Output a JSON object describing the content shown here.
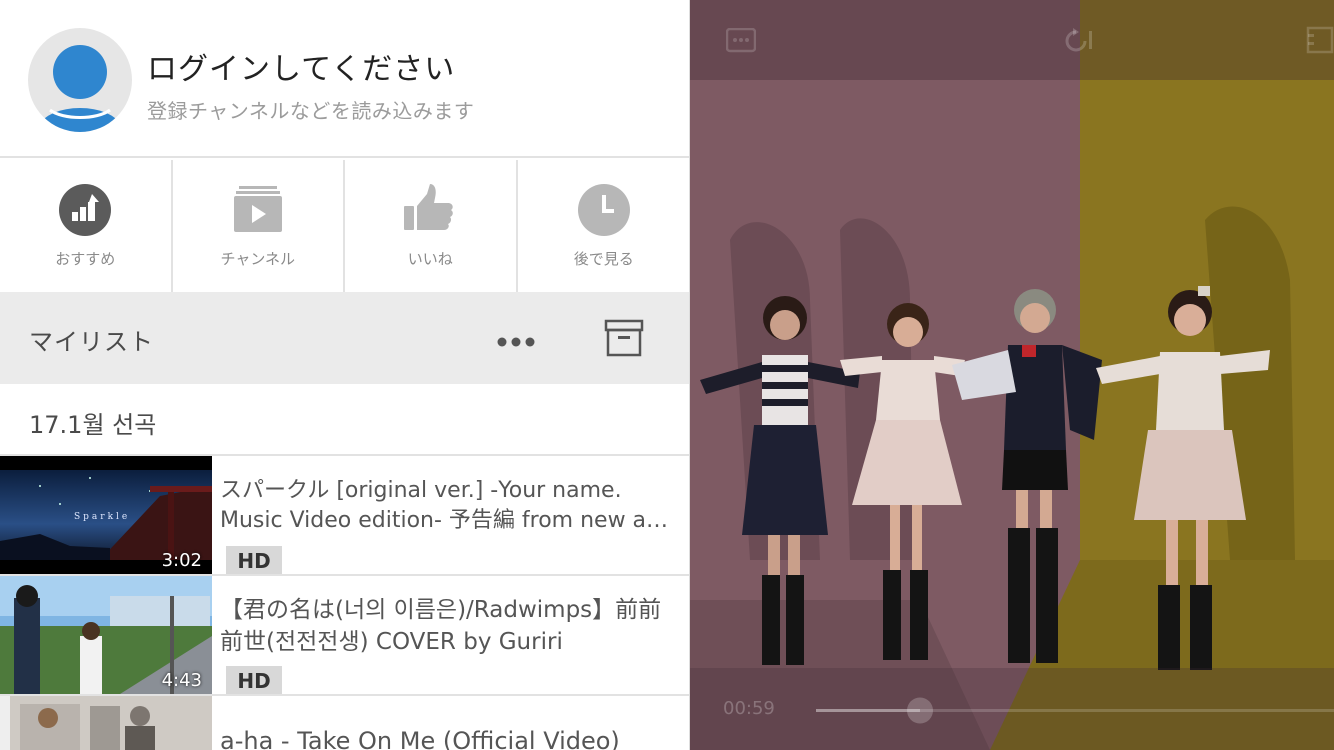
{
  "profile": {
    "title": "ログインしてください",
    "subtitle": "登録チャンネルなどを読み込みます"
  },
  "quick_actions": [
    {
      "label": "おすすめ",
      "icon": "chart-icon"
    },
    {
      "label": "チャンネル",
      "icon": "channel-icon"
    },
    {
      "label": "いいね",
      "icon": "thumbs-up-icon"
    },
    {
      "label": "後で見る",
      "icon": "clock-icon"
    }
  ],
  "mylist": {
    "title": "マイリスト",
    "playlist_name": "17.1월 선곡"
  },
  "videos": [
    {
      "title_line1": "スパークル [original ver.] -Your name.",
      "title_line2": "Music Video edition- 予告編 from new a…",
      "duration": "3:02",
      "badge": "HD",
      "thumb_text": "Sparkle"
    },
    {
      "title_line1": "【君の名は(너의 이름은)/Radwimps】前前",
      "title_line2": "前世(전전전생) COVER by Guriri",
      "duration": "4:43",
      "badge": "HD"
    },
    {
      "title_line1": "a-ha - Take On Me (Official Video)",
      "title_line2": ""
    }
  ],
  "player": {
    "current_time": "00:59",
    "progress": 0.2,
    "colors": {
      "pink": "#7e5a63",
      "yellow": "#8a7520"
    }
  },
  "colors": {
    "avatar_blue": "#2f86cf",
    "icon_gray": "#5b5b5b",
    "icon_light": "#b7b7b7"
  }
}
